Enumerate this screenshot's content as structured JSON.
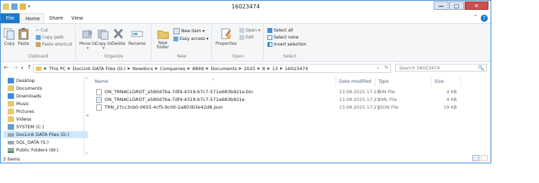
{
  "window": {
    "title": "16023474"
  },
  "window_buttons": {
    "minimize": "—",
    "maximize": "□",
    "close": "✕"
  },
  "tabs": [
    {
      "label": "File"
    },
    {
      "label": "Home"
    },
    {
      "label": "Share"
    },
    {
      "label": "View"
    }
  ],
  "ribbon": {
    "clipboard": {
      "label": "Clipboard",
      "copy": "Copy",
      "paste": "Paste",
      "cut": "Cut",
      "copy_path": "Copy path",
      "paste_shortcut": "Paste shortcut"
    },
    "organize": {
      "label": "Organize",
      "move_to": "Move to",
      "copy_to": "Copy to",
      "delete": "Delete",
      "rename": "Rename",
      "move_to_chev": "▾",
      "copy_to_chev": "▾"
    },
    "new": {
      "label": "New",
      "new_folder": "New folder",
      "new_item": "New item ▾",
      "easy_access": "Easy access ▾"
    },
    "open": {
      "label": "Open",
      "properties": "Properties",
      "open": "Open ▾",
      "edit": "Edit"
    },
    "select": {
      "label": "Select",
      "select_all": "Select all",
      "select_none": "Select none",
      "invert": "Invert selection"
    }
  },
  "nav": {
    "back": "←",
    "forward": "→",
    "up": "↑",
    "refresh": "↻",
    "dropdown": "⌄"
  },
  "address": {
    "segments": [
      "This PC",
      "DocLink DATA Files (D:)",
      "Newdocs",
      "Companies",
      "8869",
      "Documents",
      "2025",
      "8",
      "13",
      "16023474"
    ],
    "separator": "▶"
  },
  "search": {
    "placeholder": "Search 16023474",
    "icon": "🔍"
  },
  "tree": [
    {
      "label": "Desktop",
      "icon": "desktop-icon",
      "color": "#3a8fd8"
    },
    {
      "label": "Documents",
      "icon": "documents-icon",
      "color": "#e8c86a"
    },
    {
      "label": "Downloads",
      "icon": "downloads-icon",
      "color": "#3a8fd8"
    },
    {
      "label": "Music",
      "icon": "music-icon",
      "color": "#e8c86a"
    },
    {
      "label": "Pictures",
      "icon": "pictures-icon",
      "color": "#e8c86a"
    },
    {
      "label": "Videos",
      "icon": "videos-icon",
      "color": "#e8c86a"
    },
    {
      "label": "SYSTEM (C:)",
      "icon": "drive-icon",
      "color": "#5aa0d8"
    },
    {
      "label": "DocLink DATA Files (D:)",
      "icon": "drive-icon",
      "color": "#9aa4ae",
      "selected": true
    },
    {
      "label": "SQL_DATA (S:)",
      "icon": "drive-icon",
      "color": "#9aa4ae"
    },
    {
      "label": "Public Folders (W:)",
      "icon": "network-drive-icon",
      "color": "#9aa4ae"
    }
  ],
  "columns": {
    "name": "Name",
    "date": "Date modified",
    "type": "Type",
    "size": "Size"
  },
  "files": [
    {
      "name": "ON_TRNACLGROT_a580d7ba-7df4-4319-b7c7-571e683b921e.bin",
      "date": "13.08.2025 17:21",
      "type": "BIN File",
      "size": "4 KB"
    },
    {
      "name": "ON_TRNACLGROT_a580d7ba-7df4-4319-b7c7-571e683b921e",
      "date": "13.08.2025 17:21",
      "type": "XML File",
      "size": "4 KB"
    },
    {
      "name": "TRN_27cc3cb0-0655-4cf5-9c00-2a803b3e42d8.json",
      "date": "13.08.2025 17:21",
      "type": "JSON File",
      "size": "19 KB"
    }
  ],
  "status": {
    "count": "3 items"
  },
  "colors": {
    "accent": "#1979ca",
    "folder": "#e8c86a",
    "selection": "#cce8ff",
    "close": "#c75050"
  }
}
